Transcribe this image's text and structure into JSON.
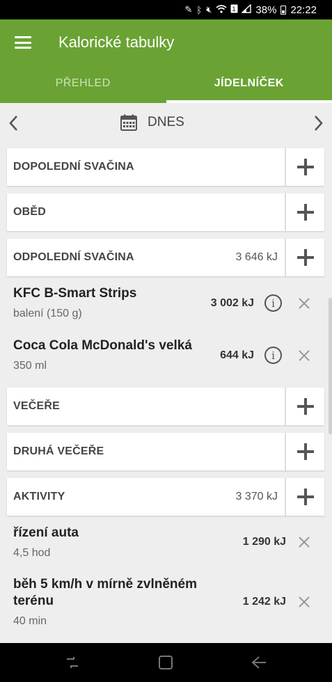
{
  "status_bar": {
    "icons": [
      "pen-icon",
      "bluetooth-icon",
      "mute-icon",
      "wifi-icon",
      "sim-icon",
      "signal-icon"
    ],
    "battery": "38%",
    "time": "22:22"
  },
  "app": {
    "title": "Kalorické tabulky",
    "accent_color": "#6aa334"
  },
  "tabs": [
    {
      "label": "PŘEHLED",
      "active": false
    },
    {
      "label": "JÍDELNÍČEK",
      "active": true
    }
  ],
  "date_nav": {
    "label": "DNES"
  },
  "sections": [
    {
      "name": "DOPOLEDNÍ SVAČINA",
      "kj": ""
    },
    {
      "name": "OBĚD",
      "kj": ""
    },
    {
      "name": "ODPOLEDNÍ SVAČINA",
      "kj": "3 646 kJ"
    },
    {
      "name": "VEČEŘE",
      "kj": ""
    },
    {
      "name": "DRUHÁ VEČEŘE",
      "kj": ""
    },
    {
      "name": "AKTIVITY",
      "kj": "3 370 kJ"
    }
  ],
  "food_items": [
    {
      "name": "KFC B-Smart Strips",
      "detail": "balení (150 g)",
      "kj": "3 002 kJ"
    },
    {
      "name": "Coca Cola McDonald's velká",
      "detail": "350 ml",
      "kj": "644 kJ"
    }
  ],
  "activity_items": [
    {
      "name": "řízení auta",
      "detail": "4,5 hod",
      "kj": "1 290 kJ"
    },
    {
      "name": "běh 5 km/h v mírně zvlněném terénu",
      "detail": "40 min",
      "kj": "1 242 kJ"
    }
  ]
}
